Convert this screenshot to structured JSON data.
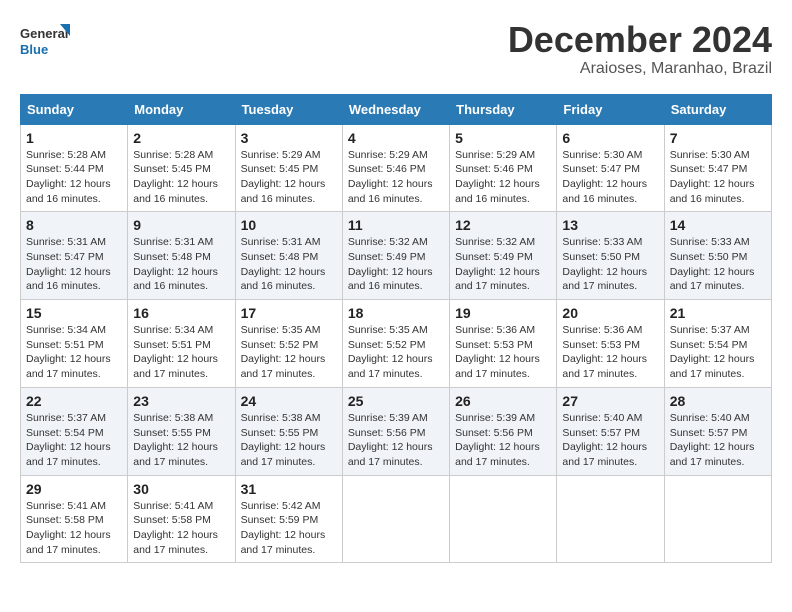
{
  "logo": {
    "line1": "General",
    "line2": "Blue"
  },
  "title": "December 2024",
  "subtitle": "Araioses, Maranhao, Brazil",
  "calendar": {
    "headers": [
      "Sunday",
      "Monday",
      "Tuesday",
      "Wednesday",
      "Thursday",
      "Friday",
      "Saturday"
    ],
    "weeks": [
      [
        {
          "day": "1",
          "sunrise": "5:28 AM",
          "sunset": "5:44 PM",
          "daylight": "12 hours and 16 minutes."
        },
        {
          "day": "2",
          "sunrise": "5:28 AM",
          "sunset": "5:45 PM",
          "daylight": "12 hours and 16 minutes."
        },
        {
          "day": "3",
          "sunrise": "5:29 AM",
          "sunset": "5:45 PM",
          "daylight": "12 hours and 16 minutes."
        },
        {
          "day": "4",
          "sunrise": "5:29 AM",
          "sunset": "5:46 PM",
          "daylight": "12 hours and 16 minutes."
        },
        {
          "day": "5",
          "sunrise": "5:29 AM",
          "sunset": "5:46 PM",
          "daylight": "12 hours and 16 minutes."
        },
        {
          "day": "6",
          "sunrise": "5:30 AM",
          "sunset": "5:47 PM",
          "daylight": "12 hours and 16 minutes."
        },
        {
          "day": "7",
          "sunrise": "5:30 AM",
          "sunset": "5:47 PM",
          "daylight": "12 hours and 16 minutes."
        }
      ],
      [
        {
          "day": "8",
          "sunrise": "5:31 AM",
          "sunset": "5:47 PM",
          "daylight": "12 hours and 16 minutes."
        },
        {
          "day": "9",
          "sunrise": "5:31 AM",
          "sunset": "5:48 PM",
          "daylight": "12 hours and 16 minutes."
        },
        {
          "day": "10",
          "sunrise": "5:31 AM",
          "sunset": "5:48 PM",
          "daylight": "12 hours and 16 minutes."
        },
        {
          "day": "11",
          "sunrise": "5:32 AM",
          "sunset": "5:49 PM",
          "daylight": "12 hours and 16 minutes."
        },
        {
          "day": "12",
          "sunrise": "5:32 AM",
          "sunset": "5:49 PM",
          "daylight": "12 hours and 17 minutes."
        },
        {
          "day": "13",
          "sunrise": "5:33 AM",
          "sunset": "5:50 PM",
          "daylight": "12 hours and 17 minutes."
        },
        {
          "day": "14",
          "sunrise": "5:33 AM",
          "sunset": "5:50 PM",
          "daylight": "12 hours and 17 minutes."
        }
      ],
      [
        {
          "day": "15",
          "sunrise": "5:34 AM",
          "sunset": "5:51 PM",
          "daylight": "12 hours and 17 minutes."
        },
        {
          "day": "16",
          "sunrise": "5:34 AM",
          "sunset": "5:51 PM",
          "daylight": "12 hours and 17 minutes."
        },
        {
          "day": "17",
          "sunrise": "5:35 AM",
          "sunset": "5:52 PM",
          "daylight": "12 hours and 17 minutes."
        },
        {
          "day": "18",
          "sunrise": "5:35 AM",
          "sunset": "5:52 PM",
          "daylight": "12 hours and 17 minutes."
        },
        {
          "day": "19",
          "sunrise": "5:36 AM",
          "sunset": "5:53 PM",
          "daylight": "12 hours and 17 minutes."
        },
        {
          "day": "20",
          "sunrise": "5:36 AM",
          "sunset": "5:53 PM",
          "daylight": "12 hours and 17 minutes."
        },
        {
          "day": "21",
          "sunrise": "5:37 AM",
          "sunset": "5:54 PM",
          "daylight": "12 hours and 17 minutes."
        }
      ],
      [
        {
          "day": "22",
          "sunrise": "5:37 AM",
          "sunset": "5:54 PM",
          "daylight": "12 hours and 17 minutes."
        },
        {
          "day": "23",
          "sunrise": "5:38 AM",
          "sunset": "5:55 PM",
          "daylight": "12 hours and 17 minutes."
        },
        {
          "day": "24",
          "sunrise": "5:38 AM",
          "sunset": "5:55 PM",
          "daylight": "12 hours and 17 minutes."
        },
        {
          "day": "25",
          "sunrise": "5:39 AM",
          "sunset": "5:56 PM",
          "daylight": "12 hours and 17 minutes."
        },
        {
          "day": "26",
          "sunrise": "5:39 AM",
          "sunset": "5:56 PM",
          "daylight": "12 hours and 17 minutes."
        },
        {
          "day": "27",
          "sunrise": "5:40 AM",
          "sunset": "5:57 PM",
          "daylight": "12 hours and 17 minutes."
        },
        {
          "day": "28",
          "sunrise": "5:40 AM",
          "sunset": "5:57 PM",
          "daylight": "12 hours and 17 minutes."
        }
      ],
      [
        {
          "day": "29",
          "sunrise": "5:41 AM",
          "sunset": "5:58 PM",
          "daylight": "12 hours and 17 minutes."
        },
        {
          "day": "30",
          "sunrise": "5:41 AM",
          "sunset": "5:58 PM",
          "daylight": "12 hours and 17 minutes."
        },
        {
          "day": "31",
          "sunrise": "5:42 AM",
          "sunset": "5:59 PM",
          "daylight": "12 hours and 17 minutes."
        },
        null,
        null,
        null,
        null
      ]
    ],
    "labels": {
      "sunrise": "Sunrise:",
      "sunset": "Sunset:",
      "daylight": "Daylight:"
    }
  }
}
